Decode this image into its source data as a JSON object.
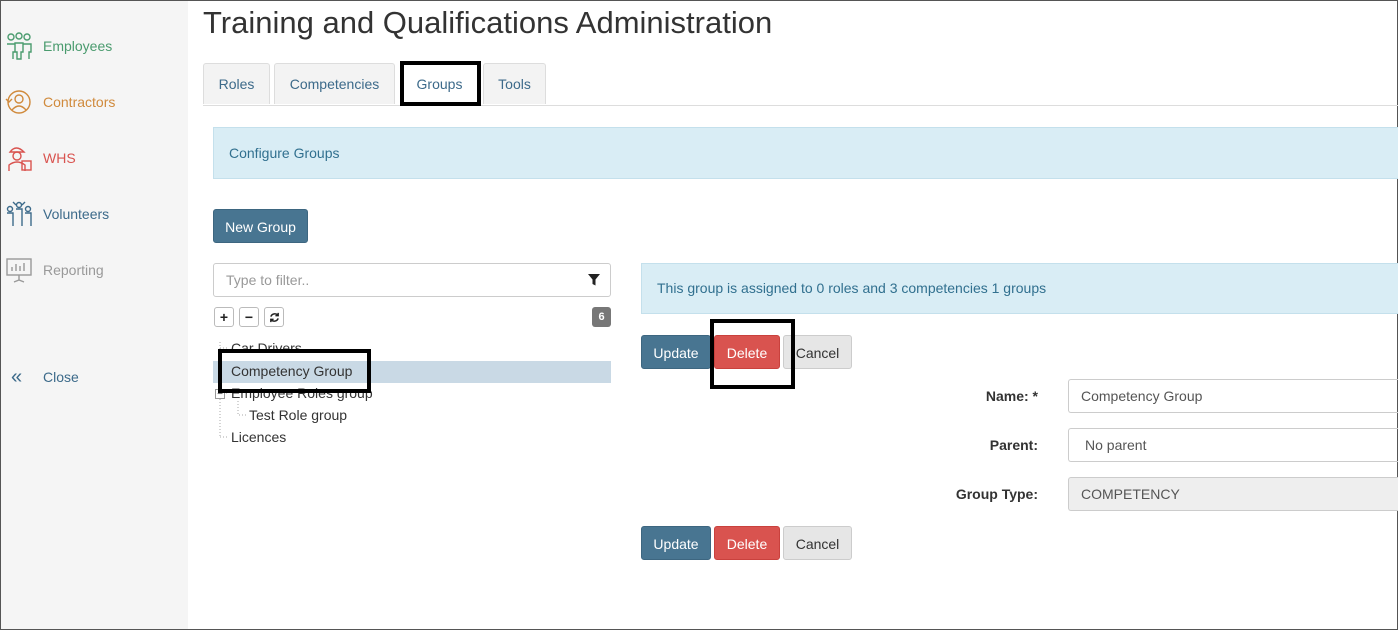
{
  "sidebar": {
    "items": [
      {
        "label": "Employees",
        "color": "#4a9b6e",
        "icon": "employees-icon"
      },
      {
        "label": "Contractors",
        "color": "#d08a3c",
        "icon": "contractors-icon"
      },
      {
        "label": "WHS",
        "color": "#d9534f",
        "icon": "whs-icon"
      },
      {
        "label": "Volunteers",
        "color": "#3c6a8a",
        "icon": "volunteers-icon"
      },
      {
        "label": "Reporting",
        "color": "#999999",
        "icon": "reporting-icon"
      }
    ],
    "close_label": "Close"
  },
  "page": {
    "title": "Training and Qualifications Administration"
  },
  "tabs": [
    {
      "label": "Roles",
      "active": false
    },
    {
      "label": "Competencies",
      "active": false
    },
    {
      "label": "Groups",
      "active": true
    },
    {
      "label": "Tools",
      "active": false
    }
  ],
  "banner": {
    "text": "Configure Groups"
  },
  "actions": {
    "new_group_label": "New Group"
  },
  "filter": {
    "placeholder": "Type to filter..",
    "icon": "filter-icon"
  },
  "tree": {
    "controls": {
      "expand": "+",
      "collapse": "−",
      "refresh_icon": "refresh-icon"
    },
    "count": "6",
    "nodes": [
      {
        "label": "Car Drivers",
        "level": 0
      },
      {
        "label": "Competency Group",
        "level": 0,
        "selected": true
      },
      {
        "label": "Employee Roles group",
        "level": 0
      },
      {
        "label": "Test Role group",
        "level": 1
      },
      {
        "label": "Licences",
        "level": 0
      }
    ]
  },
  "detail": {
    "info": "This group is assigned to 0 roles and 3 competencies 1 groups",
    "update_label": "Update",
    "delete_label": "Delete",
    "cancel_label": "Cancel",
    "name_label": "Name: *",
    "name_value": "Competency Group",
    "parent_label": "Parent:",
    "parent_value": "No parent",
    "group_type_label": "Group Type:",
    "group_type_value": "COMPETENCY"
  },
  "colors": {
    "primary": "#487591",
    "danger": "#d9534f",
    "info_bg": "#d9edf5",
    "info_text": "#31708f"
  }
}
